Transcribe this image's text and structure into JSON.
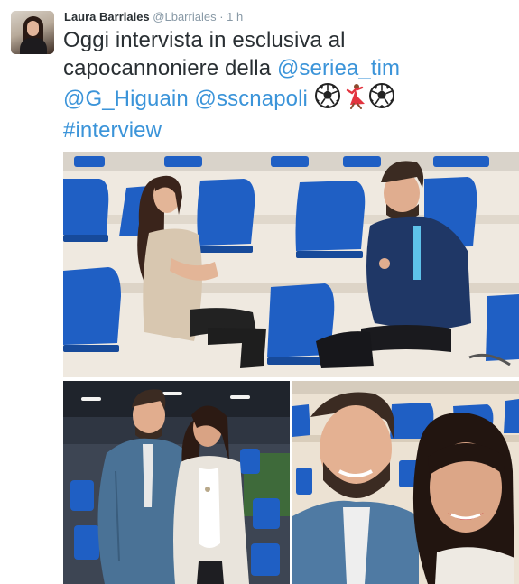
{
  "tweet": {
    "author_name": "Laura Barriales",
    "author_handle": "@Lbarriales",
    "separator": "·",
    "time": "1 h",
    "text": {
      "line1": "Oggi intervista in esclusiva al",
      "line2_text": "capocannoniere della ",
      "mention_serie": "@seriea_tim",
      "mention_higuain": "@G_Higuain",
      "mention_napoli": "@sscnapoli",
      "hashtag": "#interview"
    },
    "emojis": [
      "soccer-ball",
      "dancer",
      "soccer-ball"
    ]
  },
  "media": [
    {
      "name": "interview-photo"
    },
    {
      "name": "standing-photo"
    },
    {
      "name": "selfie-photo"
    }
  ],
  "colors": {
    "link": "#3b94d9",
    "text": "#292f33",
    "muted": "#8899a6",
    "seat_blue": "#1f5fc4"
  }
}
